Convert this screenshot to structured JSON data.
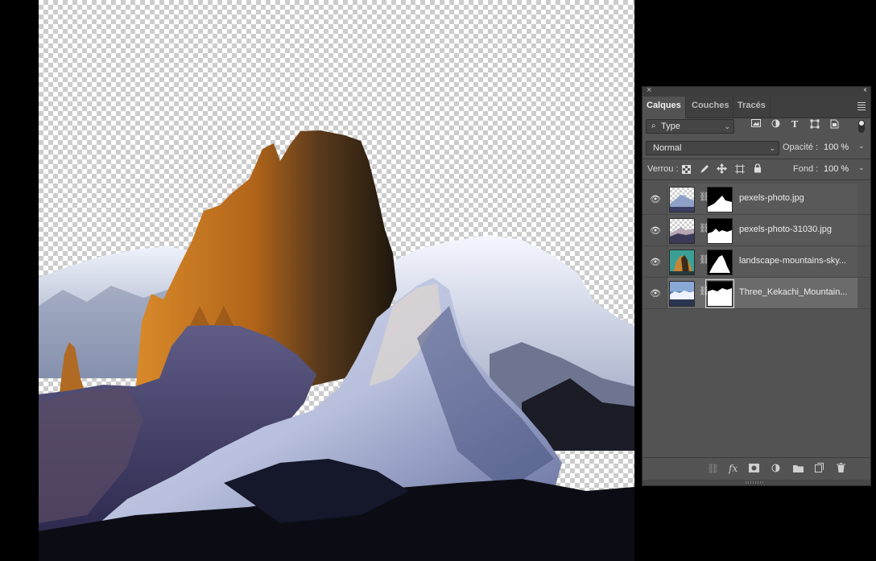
{
  "panel": {
    "close_icon": "×",
    "collapse_icon": "‹‹",
    "tabs": [
      {
        "label": "Calques",
        "active": true
      },
      {
        "label": "Couches",
        "active": false
      },
      {
        "label": "Tracés",
        "active": false
      }
    ],
    "filter": {
      "label": "Type",
      "prefix_icon": "⌕"
    },
    "filter_icons": [
      "image-filter-icon",
      "adjustment-filter-icon",
      "type-filter-icon",
      "shape-filter-icon",
      "smart-object-filter-icon"
    ],
    "blend_mode": "Normal",
    "opacity_label": "Opacité :",
    "opacity_value": "100 %",
    "lock_label": "Verrou :",
    "lock_icons": [
      "lock-transparency-icon",
      "lock-pixels-icon",
      "lock-position-icon",
      "lock-artboard-icon",
      "lock-all-icon"
    ],
    "fill_label": "Fond :",
    "fill_value": "100 %",
    "layers": [
      {
        "name": "pexels-photo.jpg",
        "visible": true,
        "selected": false,
        "has_mask": true
      },
      {
        "name": "pexels-photo-31030.jpg",
        "visible": true,
        "selected": false,
        "has_mask": true
      },
      {
        "name": "landscape-mountains-sky...",
        "visible": true,
        "selected": false,
        "has_mask": true
      },
      {
        "name": "Three_Kekachi_Mountain...",
        "visible": true,
        "selected": true,
        "has_mask": true
      }
    ],
    "footer_icons": [
      "link-layers-icon",
      "fx-icon",
      "add-mask-icon",
      "adjustment-layer-icon",
      "group-folder-icon",
      "new-layer-icon",
      "trash-icon"
    ],
    "footer_fx": "fx"
  },
  "colors": {
    "panel_bg": "#535353",
    "selected_layer": "#6b6b6b",
    "workspace_bg": "#000000"
  }
}
